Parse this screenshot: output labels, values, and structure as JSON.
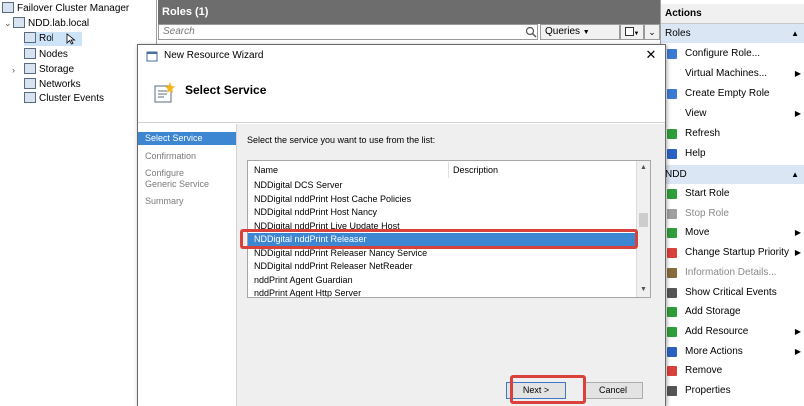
{
  "tree": {
    "root": "Failover Cluster Manager",
    "cluster": "NDD.lab.local",
    "items": [
      {
        "label": "Roles"
      },
      {
        "label": "Nodes"
      },
      {
        "label": "Storage"
      },
      {
        "label": "Networks"
      },
      {
        "label": "Cluster Events"
      }
    ]
  },
  "roles_pane": {
    "title": "Roles (1)",
    "search_placeholder": "Search",
    "queries_label": "Queries",
    "queries_arrow": "▼",
    "save_glyph": "▼",
    "expand_glyph": "⌄"
  },
  "actions": {
    "header": "Actions",
    "roles_section": "Roles",
    "roles_items": [
      {
        "label": "Configure Role...",
        "icon": "configure-icon",
        "color": "#3a7bd5",
        "sub": ""
      },
      {
        "label": "Virtual Machines...",
        "icon": "",
        "color": "",
        "sub": "▶"
      },
      {
        "label": "Create Empty Role",
        "icon": "empty-role-icon",
        "color": "#3a7bd5",
        "sub": ""
      },
      {
        "label": "View",
        "icon": "",
        "color": "",
        "sub": "▶"
      },
      {
        "label": "Refresh",
        "icon": "refresh-icon",
        "color": "#2e9e3a",
        "sub": ""
      },
      {
        "label": "Help",
        "icon": "help-icon",
        "color": "#2a62c4",
        "sub": ""
      }
    ],
    "ndd_section": "NDD",
    "ndd_items": [
      {
        "label": "Start Role",
        "icon": "start-icon",
        "color": "#2e9e3a",
        "disabled": false,
        "sub": ""
      },
      {
        "label": "Stop Role",
        "icon": "stop-icon",
        "color": "#a0a0a0",
        "disabled": true,
        "sub": ""
      },
      {
        "label": "Move",
        "icon": "move-icon",
        "color": "#2e9e3a",
        "disabled": false,
        "sub": "▶"
      },
      {
        "label": "Change Startup Priority",
        "icon": "priority-icon",
        "color": "#d9413a",
        "disabled": false,
        "sub": "▶"
      },
      {
        "label": "Information Details...",
        "icon": "info-icon",
        "color": "#8a6b3a",
        "disabled": true,
        "sub": ""
      },
      {
        "label": "Show Critical Events",
        "icon": "events-icon",
        "color": "#555555",
        "disabled": false,
        "sub": ""
      },
      {
        "label": "Add Storage",
        "icon": "add-storage-icon",
        "color": "#2e9e3a",
        "disabled": false,
        "sub": ""
      },
      {
        "label": "Add Resource",
        "icon": "add-resource-icon",
        "color": "#2e9e3a",
        "disabled": false,
        "sub": "▶"
      },
      {
        "label": "More Actions",
        "icon": "more-actions-icon",
        "color": "#2a62c4",
        "disabled": false,
        "sub": "▶"
      },
      {
        "label": "Remove",
        "icon": "remove-icon",
        "color": "#d9413a",
        "disabled": false,
        "sub": ""
      },
      {
        "label": "Properties",
        "icon": "properties-icon",
        "color": "#555555",
        "disabled": false,
        "sub": ""
      }
    ]
  },
  "dialog": {
    "title": "New Resource Wizard",
    "close_glyph": "✕",
    "heading": "Select Service",
    "steps": [
      {
        "label": "Select Service",
        "active": true
      },
      {
        "label": "Confirmation",
        "active": false
      },
      {
        "label": "Configure Generic Service",
        "active": false
      },
      {
        "label": "Summary",
        "active": false
      }
    ],
    "prompt": "Select the service you want to use from the list:",
    "columns": {
      "name": "Name",
      "description": "Description"
    },
    "services": [
      {
        "name": "NDDigital DCS Server",
        "selected": false
      },
      {
        "name": "NDDigital nddPrint Host Cache Policies",
        "selected": false
      },
      {
        "name": "NDDigital nddPrint Host Nancy",
        "selected": false
      },
      {
        "name": "NDDigital nddPrint Live Update Host",
        "selected": false
      },
      {
        "name": "NDDigital nddPrint Releaser",
        "selected": true
      },
      {
        "name": "NDDigital nddPrint Releaser Nancy Service",
        "selected": false
      },
      {
        "name": "NDDigital nddPrint Releaser NetReader",
        "selected": false
      },
      {
        "name": "nddPrint Agent Guardian",
        "selected": false
      },
      {
        "name": "nddPrint Agent Http Server",
        "selected": false
      }
    ],
    "next_label": "Next >",
    "cancel_label": "Cancel",
    "highlight_color": "#d9413a",
    "selection_color": "#3d86d2"
  }
}
